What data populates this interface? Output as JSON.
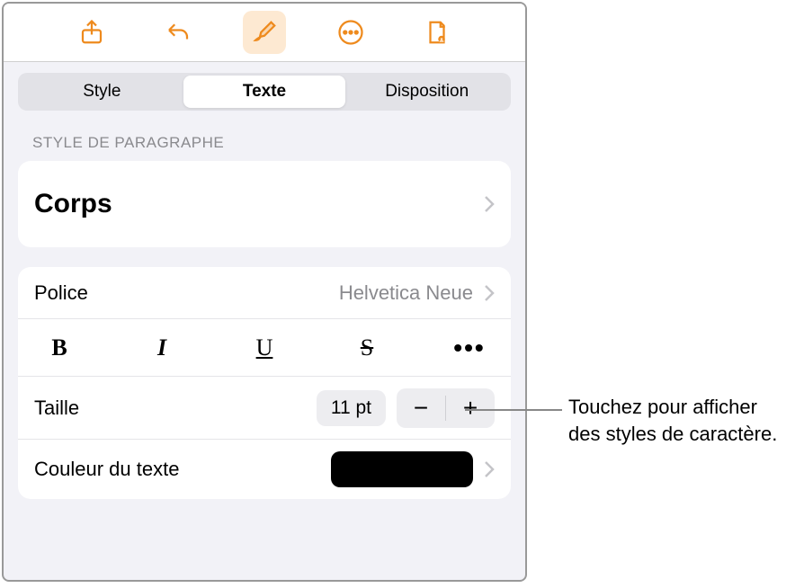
{
  "toolbar": {
    "share": "share",
    "undo": "undo",
    "format": "format-brush",
    "more": "more",
    "document": "document-options"
  },
  "tabs": {
    "style": "Style",
    "text": "Texte",
    "layout": "Disposition"
  },
  "sectionHeader": "Style de paragraphe",
  "paragraphStyle": "Corps",
  "font": {
    "label": "Police",
    "value": "Helvetica Neue"
  },
  "styleButtons": {
    "bold": "B",
    "italic": "I",
    "underline": "U",
    "strike": "S",
    "more": "•••"
  },
  "size": {
    "label": "Taille",
    "value": "11 pt",
    "minus": "−",
    "plus": "+"
  },
  "textColor": {
    "label": "Couleur du texte",
    "value": "#000000"
  },
  "callout": "Touchez pour afficher des styles de caractère."
}
